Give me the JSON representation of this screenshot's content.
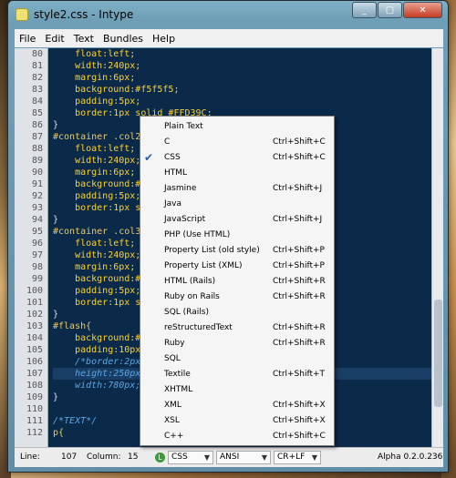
{
  "window": {
    "title": "style2.css - Intype",
    "buttons": [
      "_",
      "▢",
      "✕"
    ]
  },
  "menu": [
    "File",
    "Edit",
    "Text",
    "Bundles",
    "Help"
  ],
  "editor": {
    "lines": [
      {
        "n": "80",
        "parts": [
          [
            "prop",
            "    float:left;"
          ]
        ]
      },
      {
        "n": "81",
        "parts": [
          [
            "prop",
            "    width:240px;"
          ]
        ]
      },
      {
        "n": "82",
        "parts": [
          [
            "prop",
            "    margin:6px;"
          ]
        ]
      },
      {
        "n": "83",
        "parts": [
          [
            "prop",
            "    background:#f5f5f5;"
          ]
        ]
      },
      {
        "n": "84",
        "parts": [
          [
            "prop",
            "    padding:5px;"
          ]
        ]
      },
      {
        "n": "85",
        "parts": [
          [
            "prop",
            "    border:1px solid #FFD39C;"
          ]
        ]
      },
      {
        "n": "86",
        "parts": [
          [
            "brace",
            "}"
          ]
        ]
      },
      {
        "n": "87",
        "parts": [
          [
            "sel",
            "#container .col2{"
          ]
        ]
      },
      {
        "n": "88",
        "parts": [
          [
            "prop",
            "    float:left;"
          ]
        ]
      },
      {
        "n": "89",
        "parts": [
          [
            "prop",
            "    width:240px;"
          ]
        ]
      },
      {
        "n": "90",
        "parts": [
          [
            "prop",
            "    margin:6px;"
          ]
        ]
      },
      {
        "n": "91",
        "parts": [
          [
            "prop",
            "    background:#f"
          ]
        ]
      },
      {
        "n": "92",
        "parts": [
          [
            "prop",
            "    padding:5px;"
          ]
        ]
      },
      {
        "n": "93",
        "parts": [
          [
            "prop",
            "    border:1px so"
          ]
        ]
      },
      {
        "n": "94",
        "parts": [
          [
            "brace",
            "}"
          ]
        ]
      },
      {
        "n": "95",
        "parts": [
          [
            "sel",
            "#container .col3{"
          ]
        ]
      },
      {
        "n": "96",
        "parts": [
          [
            "prop",
            "    float:left;"
          ]
        ]
      },
      {
        "n": "97",
        "parts": [
          [
            "prop",
            "    width:240px;"
          ]
        ]
      },
      {
        "n": "98",
        "parts": [
          [
            "prop",
            "    margin:6px;"
          ]
        ]
      },
      {
        "n": "99",
        "parts": [
          [
            "prop",
            "    background:#f"
          ]
        ]
      },
      {
        "n": "100",
        "parts": [
          [
            "prop",
            "    padding:5px;"
          ]
        ]
      },
      {
        "n": "101",
        "parts": [
          [
            "prop",
            "    border:1px so"
          ]
        ]
      },
      {
        "n": "102",
        "parts": [
          [
            "brace",
            "}"
          ]
        ]
      },
      {
        "n": "103",
        "parts": [
          [
            "sel",
            "#flash{"
          ]
        ]
      },
      {
        "n": "104",
        "parts": [
          [
            "prop",
            "    background:#"
          ]
        ]
      },
      {
        "n": "105",
        "parts": [
          [
            "prop",
            "    padding:10px"
          ]
        ]
      },
      {
        "n": "106",
        "parts": [
          [
            "cmt",
            "    /*border:2px"
          ]
        ]
      },
      {
        "n": "107",
        "parts": [
          [
            "cmt",
            "    height:250px;"
          ]
        ],
        "current": true
      },
      {
        "n": "108",
        "parts": [
          [
            "cmt",
            "    width:780px;"
          ]
        ]
      },
      {
        "n": "109",
        "parts": [
          [
            "brace",
            "}"
          ]
        ]
      },
      {
        "n": "110",
        "parts": [
          [
            "brace",
            ""
          ]
        ]
      },
      {
        "n": "111",
        "parts": [
          [
            "cmt",
            "/*TEXT*/"
          ]
        ]
      },
      {
        "n": "112",
        "parts": [
          [
            "sel",
            "p{"
          ]
        ]
      }
    ]
  },
  "status": {
    "line_label": "Line:",
    "line_value": "107",
    "column_label": "Column:",
    "column_value": "15",
    "language": "CSS",
    "encoding": "ANSI",
    "line_ending": "CR+LF",
    "version": "Alpha 0.2.0.236"
  },
  "dropdown": {
    "items": [
      {
        "name": "Plain Text",
        "shortcut": "",
        "checked": false
      },
      {
        "name": "C",
        "shortcut": "Ctrl+Shift+C",
        "checked": false
      },
      {
        "name": "CSS",
        "shortcut": "Ctrl+Shift+C",
        "checked": true
      },
      {
        "name": "HTML",
        "shortcut": "",
        "checked": false
      },
      {
        "name": "Jasmine",
        "shortcut": "Ctrl+Shift+J",
        "checked": false
      },
      {
        "name": "Java",
        "shortcut": "",
        "checked": false
      },
      {
        "name": "JavaScript",
        "shortcut": "Ctrl+Shift+J",
        "checked": false
      },
      {
        "name": "PHP (Use HTML)",
        "shortcut": "",
        "checked": false
      },
      {
        "name": "Property List (old style)",
        "shortcut": "Ctrl+Shift+P",
        "checked": false
      },
      {
        "name": "Property List (XML)",
        "shortcut": "Ctrl+Shift+P",
        "checked": false
      },
      {
        "name": "HTML (Rails)",
        "shortcut": "Ctrl+Shift+R",
        "checked": false
      },
      {
        "name": "Ruby on Rails",
        "shortcut": "Ctrl+Shift+R",
        "checked": false
      },
      {
        "name": "SQL (Rails)",
        "shortcut": "",
        "checked": false
      },
      {
        "name": "reStructuredText",
        "shortcut": "Ctrl+Shift+R",
        "checked": false
      },
      {
        "name": "Ruby",
        "shortcut": "Ctrl+Shift+R",
        "checked": false
      },
      {
        "name": "SQL",
        "shortcut": "",
        "checked": false
      },
      {
        "name": "Textile",
        "shortcut": "Ctrl+Shift+T",
        "checked": false
      },
      {
        "name": "XHTML",
        "shortcut": "",
        "checked": false
      },
      {
        "name": "XML",
        "shortcut": "Ctrl+Shift+X",
        "checked": false
      },
      {
        "name": "XSL",
        "shortcut": "Ctrl+Shift+X",
        "checked": false
      },
      {
        "name": "C++",
        "shortcut": "Ctrl+Shift+C",
        "checked": false
      }
    ]
  }
}
